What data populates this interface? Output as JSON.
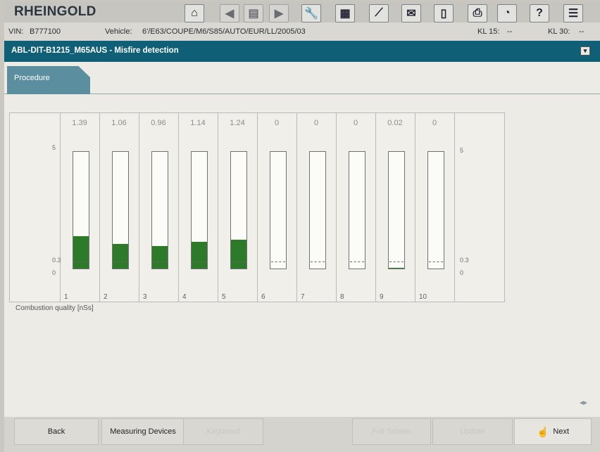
{
  "app": {
    "title": "RHEINGOLD"
  },
  "toolbar": [
    {
      "name": "home-button",
      "icon": "home-icon",
      "glyph": "⌂",
      "enabled": true
    },
    {
      "name": "back-arrow-button",
      "icon": "arrow-left-icon",
      "glyph": "◀",
      "enabled": false
    },
    {
      "name": "documents-button",
      "icon": "documents-icon",
      "glyph": "▤",
      "enabled": false
    },
    {
      "name": "forward-arrow-button",
      "icon": "arrow-right-icon",
      "glyph": "▶",
      "enabled": false
    },
    {
      "name": "workshop-button",
      "icon": "wrench-icon",
      "glyph": "🔧",
      "enabled": true
    },
    {
      "name": "vehicle-info-button",
      "icon": "vehicle-info-icon",
      "glyph": "▦",
      "enabled": true
    },
    {
      "name": "connection-button",
      "icon": "plug-icon",
      "glyph": "⟋",
      "enabled": true
    },
    {
      "name": "messages-button",
      "icon": "envelope-icon",
      "glyph": "✉",
      "enabled": true
    },
    {
      "name": "battery-button",
      "icon": "battery-icon",
      "glyph": "▯",
      "enabled": true
    },
    {
      "name": "print-button",
      "icon": "printer-icon",
      "glyph": "⎙",
      "enabled": true
    },
    {
      "name": "measurement-button",
      "icon": "gauge-icon",
      "glyph": "◔",
      "enabled": true
    },
    {
      "name": "help-button",
      "icon": "help-icon",
      "glyph": "?",
      "enabled": true
    },
    {
      "name": "menu-button",
      "icon": "list-icon",
      "glyph": "☰",
      "enabled": true
    }
  ],
  "vehicle_row": {
    "vin_label": "VIN:",
    "vin_value": "B777100",
    "vehicle_label": "Vehicle:",
    "vehicle_value": "6'/E63/COUPE/M6/S85/AUTO/EUR/LL/2005/03",
    "kl15_label": "KL 15:",
    "kl15_value": "--",
    "kl30_label": "KL 30:",
    "kl30_value": "--"
  },
  "function_bar": {
    "title": "ABL-DIT-B1215_M65AUS  -  Misfire detection",
    "minimize_glyph": "▾"
  },
  "tabs": {
    "procedure": "Procedure"
  },
  "chart_data": {
    "type": "bar",
    "categories": [
      "1",
      "2",
      "3",
      "4",
      "5",
      "6",
      "7",
      "8",
      "9",
      "10"
    ],
    "values": [
      1.39,
      1.06,
      0.96,
      1.14,
      1.24,
      0,
      0,
      0,
      0.02,
      0
    ],
    "value_labels": [
      "1.39",
      "1.06",
      "0.96",
      "1.14",
      "1.24",
      "0",
      "0",
      "0",
      "0.02",
      "0"
    ],
    "ylim": [
      0,
      5
    ],
    "threshold": 0.3,
    "y_ticks_left": [
      "5",
      "0.3",
      "0"
    ],
    "y_ticks_right": [
      "5",
      "0.3",
      "0"
    ],
    "ylabel": "Combustion quality [nSs]",
    "bar_color": "#2c7a2a"
  },
  "footer": {
    "scroll_glyph": "◂▸",
    "buttons": {
      "back": "Back",
      "measuring_devices": "Measuring Devices",
      "keyboard": "Keyboard",
      "full_screen": "Full Screen",
      "update": "Update",
      "next": "Next",
      "next_icon": "☝"
    }
  }
}
